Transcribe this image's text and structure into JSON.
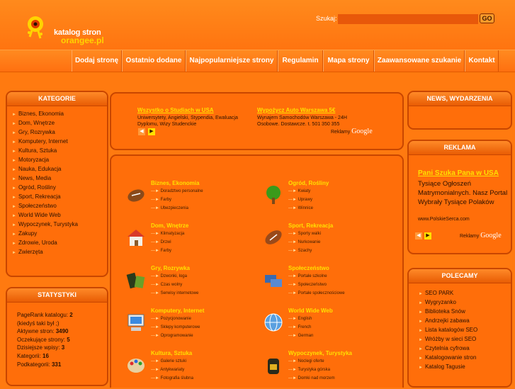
{
  "header": {
    "logo_line1": "katalog stron",
    "logo_line2": "orangee.pl",
    "search_label": "Szukaj:",
    "search_value": "",
    "go_label": "GO"
  },
  "nav": [
    "Dodaj stronę",
    "Ostatnio dodane",
    "Najpopularniejsze strony",
    "Regulamin",
    "Mapa strony",
    "Zaawansowane szukanie",
    "Kontakt"
  ],
  "kategorie": {
    "title": "KATEGORIE",
    "items": [
      "Biznes, Ekonomia",
      "Dom, Wnętrze",
      "Gry, Rozrywka",
      "Komputery, Internet",
      "Kultura, Sztuka",
      "Motoryzacja",
      "Nauka, Edukacja",
      "News, Media",
      "Ogród, Rośliny",
      "Sport, Rekreacja",
      "Społeczeństwo",
      "World Wide Web",
      "Wypoczynek, Turystyka",
      "Zakupy",
      "Zdrowie, Uroda",
      "Zwierzęta"
    ]
  },
  "statystyki": {
    "title": "STATYSTYKI",
    "pagerank_label": "PageRank katalogu:",
    "pagerank_value": "2",
    "pagerank_note": "(kiedyś taki był ;)",
    "aktywne_label": "Aktywne stron:",
    "aktywne_value": "3490",
    "oczekujace_label": "Oczekujące strony:",
    "oczekujace_value": "5",
    "dzisiejsze_label": "Dzisiejsze wpisy:",
    "dzisiejsze_value": "3",
    "kategorii_label": "Kategorii:",
    "kategorii_value": "16",
    "podkategorii_label": "Podkategorii:",
    "podkategorii_value": "331"
  },
  "ads_top": {
    "ad1_title": "Wszystko o Studiach w USA",
    "ad1_text1": "Uniwersytety, Angielski, Stypendia, Ewaluacja",
    "ad1_text2": "Dyplomu, Wizy Studenckie",
    "ad2_title": "Wypożycz Auto Warszawa 5€",
    "ad2_text1": "Wynajem Samochodów Warszawa - 24H",
    "ad2_text2": "Osobowe. Dostawcze. t. 501 350 355",
    "reklamy": "Reklamy",
    "google": "Google"
  },
  "categories_grid": [
    {
      "title": "Biznes, Ekonomia",
      "subs": [
        "Doradztwo personalne",
        "Farby",
        "Ubezpieczenia"
      ],
      "icon": "football-icon"
    },
    {
      "title": "Ogród, Rośliny",
      "subs": [
        "Kwiaty",
        "Uprawy",
        "Winnice"
      ],
      "icon": "tree-icon"
    },
    {
      "title": "Dom, Wnętrze",
      "subs": [
        "Klimatyzacja",
        "Drzwi",
        "Farby"
      ],
      "icon": "house-icon"
    },
    {
      "title": "Sport, Rekreacja",
      "subs": [
        "Sporty walki",
        "Nurkowanie",
        "Szachy"
      ],
      "icon": "rugby-ball-icon"
    },
    {
      "title": "Gry, Rozrywka",
      "subs": [
        "Dzwonki, loga",
        "Czas wolny",
        "Serwisy internetowe"
      ],
      "icon": "gamepad-icon"
    },
    {
      "title": "Społeczeństwo",
      "subs": [
        "Portale szkolne",
        "Społeczeństwo",
        "Portale społecznościowe"
      ],
      "icon": "group-icon"
    },
    {
      "title": "Komputery, Internet",
      "subs": [
        "Pozycjonowanie",
        "Sklepy komputerowe",
        "Oprogramowanie"
      ],
      "icon": "computer-icon"
    },
    {
      "title": "World Wide Web",
      "subs": [
        "English",
        "French",
        "German"
      ],
      "icon": "globe-icon"
    },
    {
      "title": "Kultura, Sztuka",
      "subs": [
        "Galerie sztuki",
        "Antykwariaty",
        "Fotografia ślubna"
      ],
      "icon": "palette-icon"
    },
    {
      "title": "Wypoczynek, Turystyka",
      "subs": [
        "Noclegi oferte",
        "Turystyka górska",
        "Domki nad morzem"
      ],
      "icon": "backpack-icon"
    }
  ],
  "news": {
    "title": "NEWS, WYDARZENIA"
  },
  "reklama": {
    "title": "REKLAMA",
    "ad_title": "Pani Szuka Pana w USA",
    "ad_text": "Tysiące Ogłoszeń Matrymonialnych. Nasz Portal Wybrały Tysiące Polaków",
    "ad_url": "www.PolskieSerca.com",
    "reklamy": "Reklamy",
    "google": "Google"
  },
  "polecamy": {
    "title": "POLECAMY",
    "items": [
      "SEO PARK",
      "Wygryzanko",
      "Biblioteka Snów",
      "Andrzejki zabawa",
      "Lista katalogów SEO",
      "Wróżby w sieci SEO",
      "Czytelnia cyfrowa",
      "Katalogowanie stron",
      "Katalog Tagusie"
    ]
  },
  "colors": {
    "accent": "#ff7a10",
    "link": "#ffe000",
    "border": "#c84600"
  }
}
